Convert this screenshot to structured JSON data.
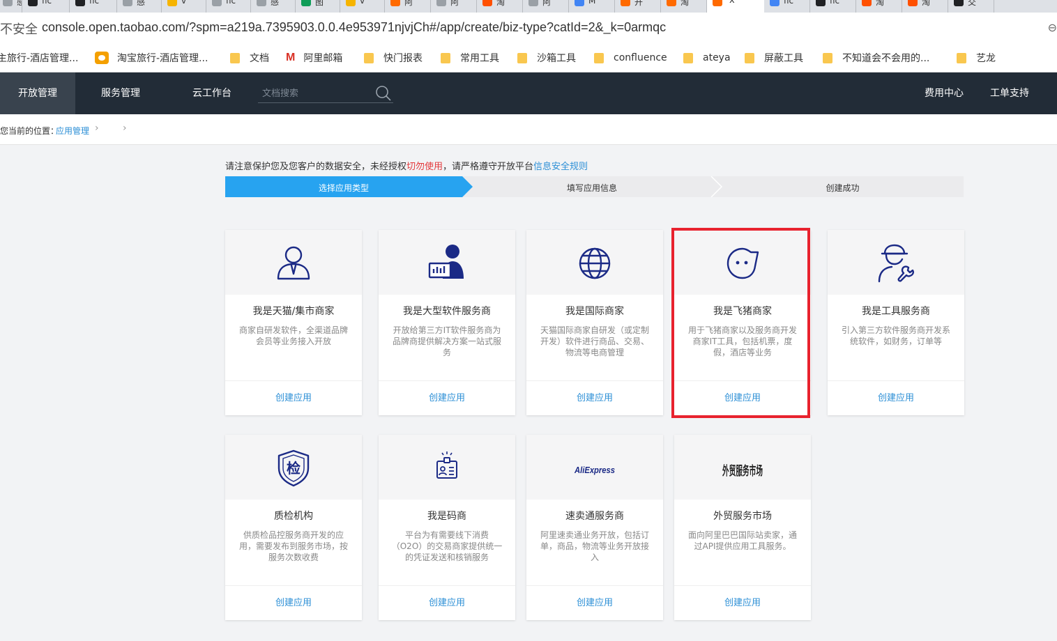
{
  "browser": {
    "tabs": [
      {
        "title": "感",
        "favicon_color": "#9aa0a6"
      },
      {
        "title": "fic",
        "favicon_color": "#202124"
      },
      {
        "title": "fic",
        "favicon_color": "#202124"
      },
      {
        "title": "感",
        "favicon_color": "#9aa0a6"
      },
      {
        "title": "v",
        "favicon_color": "#f6b400"
      },
      {
        "title": "fic",
        "favicon_color": "#9aa0a6"
      },
      {
        "title": "感",
        "favicon_color": "#9aa0a6"
      },
      {
        "title": "图",
        "favicon_color": "#0f9d58"
      },
      {
        "title": "v",
        "favicon_color": "#f6b400"
      },
      {
        "title": "阿",
        "favicon_color": "#ff6a00"
      },
      {
        "title": "阿",
        "favicon_color": "#9aa0a6"
      },
      {
        "title": "淘",
        "favicon_color": "#ff5000"
      },
      {
        "title": "阿",
        "favicon_color": "#9aa0a6"
      },
      {
        "title": "M",
        "favicon_color": "#4285f4"
      },
      {
        "title": "开",
        "favicon_color": "#ff6a00"
      },
      {
        "title": "淘",
        "favicon_color": "#ff6a00"
      },
      {
        "title": "x",
        "favicon_color": "#ff6a00",
        "active": true
      },
      {
        "title": "fic",
        "favicon_color": "#4285f4"
      },
      {
        "title": "fic",
        "favicon_color": "#202124"
      },
      {
        "title": "淘",
        "favicon_color": "#ff5000"
      },
      {
        "title": "淘",
        "favicon_color": "#ff5000"
      },
      {
        "title": "交",
        "favicon_color": "#202124"
      }
    ],
    "security_label": "不安全",
    "url": "console.open.taobao.com/?spm=a219a.7395903.0.0.4e953971njvjCh#/app/create/biz-type?catId=2&_k=0armqc",
    "bookmarks": [
      {
        "label": "主旅行-酒店管理...",
        "type": "plain"
      },
      {
        "label": "淘宝旅行-酒店管理...",
        "type": "fliggy"
      },
      {
        "label": "文档",
        "type": "folder"
      },
      {
        "label": "阿里邮箱",
        "type": "mail"
      },
      {
        "label": "快门报表",
        "type": "folder"
      },
      {
        "label": "常用工具",
        "type": "folder"
      },
      {
        "label": "沙箱工具",
        "type": "folder"
      },
      {
        "label": "confluence",
        "type": "folder"
      },
      {
        "label": "ateya",
        "type": "folder"
      },
      {
        "label": "屏蔽工具",
        "type": "folder"
      },
      {
        "label": "不知道会不会用的...",
        "type": "folder"
      },
      {
        "label": "艺龙",
        "type": "folder"
      }
    ]
  },
  "nav": {
    "items": [
      "开放管理",
      "服务管理",
      "云工作台"
    ],
    "search_placeholder": "文档搜索",
    "right_items": [
      "费用中心",
      "工单支持"
    ]
  },
  "breadcrumb": {
    "label": "您当前的位置：",
    "link": "应用管理"
  },
  "notice": {
    "part1": "请注意保护您及您客户的数据安全，未经授权",
    "warn": "切勿使用",
    "part2": "，请严格遵守开放平台",
    "link": "信息安全规则"
  },
  "steps": [
    "选择应用类型",
    "填写应用信息",
    "创建成功"
  ],
  "cards": [
    {
      "title": "我是天猫/集市商家",
      "desc": "商家自研发软件，全渠道品牌会员等业务接入开放",
      "button": "创建应用",
      "icon": "merchant-user-icon"
    },
    {
      "title": "我是大型软件服务商",
      "desc": "开放给第三方IT软件服务商为品牌商提供解决方案一站式服务",
      "button": "创建应用",
      "icon": "software-provider-icon"
    },
    {
      "title": "我是国际商家",
      "desc": "天猫国际商家自研发（或定制开发）软件进行商品、交易、物流等电商管理",
      "button": "创建应用",
      "icon": "globe-icon"
    },
    {
      "title": "我是飞猪商家",
      "desc": "用于飞猪商家以及服务商开发商家IT工具，包括机票，度假，酒店等业务",
      "button": "创建应用",
      "icon": "fliggy-icon"
    },
    {
      "title": "我是工具服务商",
      "desc": "引入第三方软件服务商开发系统软件，如财务，订单等",
      "button": "创建应用",
      "icon": "tool-provider-icon"
    },
    {
      "title": "质检机构",
      "desc": "供质检品控服务商开发的应用，需要发布到服务市场，按服务次数收费",
      "button": "创建应用",
      "icon": "inspection-shield-icon",
      "icon_text": "检"
    },
    {
      "title": "我是码商",
      "desc": "平台为有需要线下消费（O2O）的交易商家提供统一的凭证发送和核销服务",
      "button": "创建应用",
      "icon": "voucher-badge-icon"
    },
    {
      "title": "速卖通服务商",
      "desc": "阿里速卖通业务开放，包括订单，商品，物流等业务开放接入",
      "button": "创建应用",
      "icon": "aliexpress-logo-icon",
      "icon_text": "AliExpress"
    },
    {
      "title": "外贸服务市场",
      "desc": "面向阿里巴巴国际站卖家，通过API提供应用工具服务。",
      "button": "创建应用",
      "icon": "foreign-trade-logo-icon",
      "icon_text": "外贸服务市场"
    }
  ],
  "colors": {
    "nav_bg": "#222c37",
    "accent_blue": "#2c8fd6",
    "step_active": "#27a3f0",
    "highlight_red": "#e8222e",
    "icon_navy": "#1b2a86"
  }
}
